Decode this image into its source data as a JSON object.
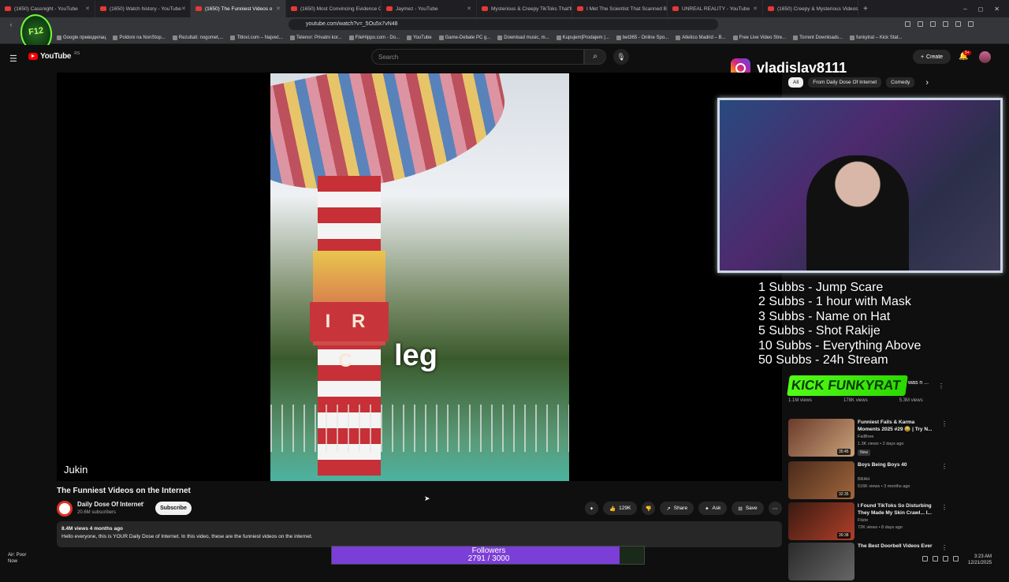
{
  "browser": {
    "tabs": [
      {
        "label": "(1650) Cassnight - YouTube",
        "active": false
      },
      {
        "label": "(1650) Watch history - YouTube",
        "active": false
      },
      {
        "label": "(1650) The Funniest Videos o",
        "active": true
      },
      {
        "label": "(1650) Most Convincing Evidence Of",
        "active": false
      },
      {
        "label": "Jaymez - YouTube",
        "active": false
      },
      {
        "label": "Mysterious & Creepy TikToks That'll",
        "active": false
      },
      {
        "label": "I Met The Scientist That Scanned Bra",
        "active": false
      },
      {
        "label": "UNREAL REALITY - YouTube",
        "active": false
      },
      {
        "label": "(1650) Creepy & Mysterious Videos",
        "active": false
      }
    ],
    "new_tab": "+",
    "window_controls": [
      "–",
      "◻",
      "✕"
    ],
    "url": "youtube.com/watch?v=_5Ou5x7vN48",
    "bookmarks": [
      "Google преводилац",
      "Poldoni na NonStop...",
      "Rezultati: nogomet,...",
      "Titlovi.com – Najveć...",
      "Telenor: Privatni kor...",
      "FileHippo.com - Do...",
      "YouTube",
      "Game-Debate PC g...",
      "Download music, m...",
      "Kupujem|Prodajem |...",
      "bet365 - Online Spo...",
      "Atletico Madrid – B...",
      "Free Live Video Stre...",
      "Torrent Downloads...",
      "funkytrat – Kick Stat..."
    ]
  },
  "overlay": {
    "logo_text": "F12",
    "instagram_handle": "vladislav8111",
    "goals": [
      "1 Subbs - Jump Scare",
      "2 Subbs - 1 hour with Mask",
      "3 Subbs - Name on Hat",
      "5 Subbs - Shot Rakije",
      "10 Subbs - Everything Above",
      "50 Subbs - 24h Stream"
    ],
    "kick_banner": "KICK FUNKYRAT",
    "followers_label": "Followers",
    "followers_count": "2791 / 3000",
    "followers_progress": 0.9303,
    "air_quality_label": "Air: Poor",
    "air_quality_sub": "Now",
    "clock_time": "3:23 AM",
    "clock_date": "12/21/2025"
  },
  "youtube": {
    "logo_word": "YouTube",
    "logo_region": "RS",
    "search_placeholder": "Search",
    "create_label": "Create",
    "notifications_badge": "9+",
    "chips": [
      "All",
      "From Daily Dose Of Internet",
      "Comedy"
    ],
    "video": {
      "caption": "leg",
      "watermark": "Jukin",
      "title": "The Funniest Videos on the Internet",
      "channel": "Daily Dose Of Internet",
      "subscribers": "20.6M subscribers",
      "subscribe_label": "Subscribe",
      "likes": "129K",
      "share_label": "Share",
      "ask_label": "Ask",
      "save_label": "Save",
      "sign_text": "I R C",
      "views_meta": "8.4M views  4 months ago",
      "description": "Hello everyone, this is YOUR Daily Dose of Internet. In this video, these are the funniest videos on the internet."
    },
    "top_row_views": [
      "1.1M views",
      "178K views",
      "5.3M views"
    ],
    "kick_side_text": "was n ...",
    "recommendations": [
      {
        "title": "Funniest Fails & Karma Moments 2025 #29 😂 | Try N...",
        "channel": "FailBree",
        "meta": "1.3K views • 2 days ago",
        "badge": "New",
        "duration": "35:45"
      },
      {
        "title": "Boys Being Boys 40",
        "channel": "BRAH",
        "meta": "516K views • 3 months ago",
        "badge": "",
        "duration": "32:35"
      },
      {
        "title": "I Found TikToks So Disturbing They Made My Skin Crawl... I...",
        "channel": "Fitzie",
        "meta": "72K views • 8 days ago",
        "badge": "",
        "duration": "39:38"
      },
      {
        "title": "The Best Doorbell Videos Ever",
        "channel": "",
        "meta": "",
        "badge": "",
        "duration": ""
      }
    ]
  }
}
